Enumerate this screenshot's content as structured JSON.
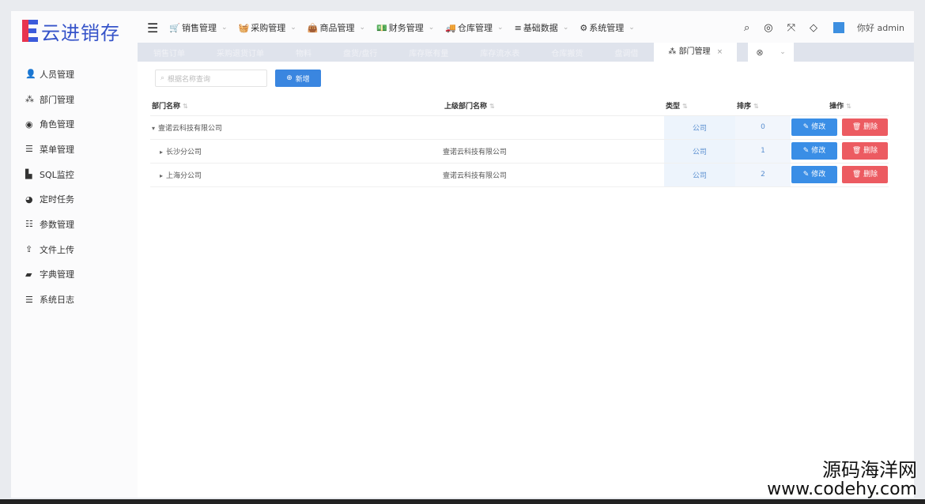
{
  "logo": {
    "text": "云进销存"
  },
  "topnav": {
    "items": [
      {
        "icon": "cart-icon",
        "glyph": "🛒",
        "label": "销售管理"
      },
      {
        "icon": "basket-icon",
        "glyph": "🧺",
        "label": "采购管理"
      },
      {
        "icon": "bag-icon",
        "glyph": "👜",
        "label": "商品管理"
      },
      {
        "icon": "money-icon",
        "glyph": "💵",
        "label": "财务管理"
      },
      {
        "icon": "truck-icon",
        "glyph": "🚚",
        "label": "仓库管理"
      },
      {
        "icon": "database-icon",
        "glyph": "≡",
        "label": "基础数据"
      },
      {
        "icon": "gear-icon",
        "glyph": "⚙",
        "label": "系统管理"
      }
    ],
    "user_greeting": "你好 admin"
  },
  "tabs": [
    {
      "label": "销售订单"
    },
    {
      "label": "采购退货订单"
    },
    {
      "label": "物料"
    },
    {
      "label": "盘货/盘行"
    },
    {
      "label": "库存账有量"
    },
    {
      "label": "库存流水表"
    },
    {
      "label": "仓库搬货"
    },
    {
      "label": "盘调借"
    }
  ],
  "active_tab": {
    "label": "部门管理"
  },
  "sidebar": {
    "items": [
      {
        "icon": "user-icon",
        "glyph": "👤",
        "label": "人员管理"
      },
      {
        "icon": "sitemap-icon",
        "glyph": "⁂",
        "label": "部门管理"
      },
      {
        "icon": "user-circle-icon",
        "glyph": "◉",
        "label": "角色管理"
      },
      {
        "icon": "list-icon",
        "glyph": "☰",
        "label": "菜单管理"
      },
      {
        "icon": "chart-icon",
        "glyph": "▙",
        "label": "SQL监控"
      },
      {
        "icon": "dashboard-icon",
        "glyph": "◕",
        "label": "定时任务"
      },
      {
        "icon": "sliders-icon",
        "glyph": "☷",
        "label": "参数管理"
      },
      {
        "icon": "upload-icon",
        "glyph": "⇪",
        "label": "文件上传"
      },
      {
        "icon": "book-icon",
        "glyph": "▰",
        "label": "字典管理"
      },
      {
        "icon": "list-ul-icon",
        "glyph": "☰",
        "label": "系统日志"
      }
    ]
  },
  "toolbar": {
    "search_placeholder": "根据名称查询",
    "add_label": "新增"
  },
  "table": {
    "headers": {
      "name": "部门名称",
      "parent": "上级部门名称",
      "type": "类型",
      "sort": "排序",
      "actions": "操作"
    },
    "rows": [
      {
        "toggle": "▾",
        "name": "壹诺云科技有限公司",
        "parent": "",
        "type": "公司",
        "sort": "0"
      },
      {
        "toggle": "▸",
        "name": "长沙分公司",
        "parent": "壹诺云科技有限公司",
        "type": "公司",
        "sort": "1"
      },
      {
        "toggle": "▸",
        "name": "上海分公司",
        "parent": "壹诺云科技有限公司",
        "type": "公司",
        "sort": "2"
      }
    ],
    "edit_label": "修改",
    "delete_label": "删除"
  },
  "watermark": {
    "line1": "源码海洋网",
    "line2": "www.codehy.com"
  },
  "colors": {
    "primary": "#3a8ee6",
    "danger": "#ec5b61",
    "brand": "#3553c9"
  }
}
